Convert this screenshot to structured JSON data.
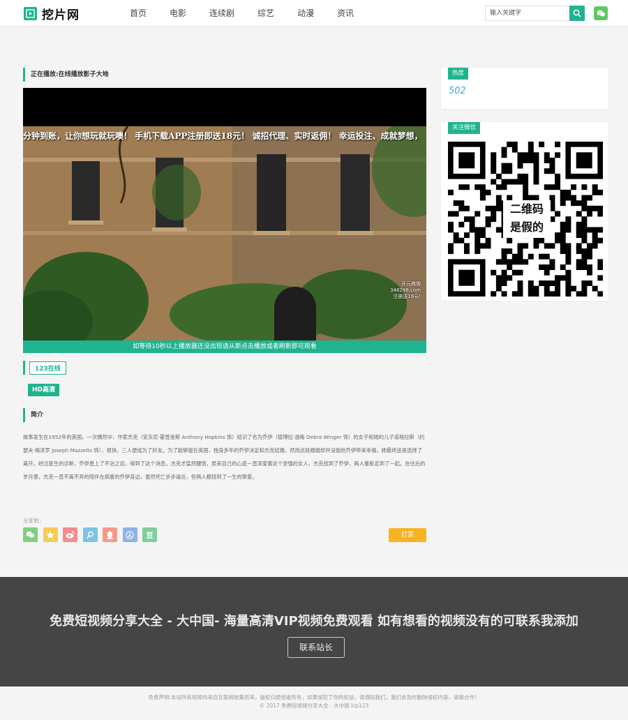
{
  "header": {
    "logo_text": "挖片网",
    "nav": [
      "首页",
      "电影",
      "连续剧",
      "综艺",
      "动漫",
      "资讯"
    ],
    "search_placeholder": "输入关键字"
  },
  "main": {
    "now_playing": "正在播放:在线播放影子大地",
    "marquee": "分钟到账，让你想玩就玩噢！ 手机下载APP注册即送18元！ 诚招代理、实时返佣！ 幸运投注、成就梦想，",
    "video_watermark": [
      "开元棋牌",
      "348298.com",
      "注册送18元!"
    ],
    "player_notice": "如等待10秒以上播放器还没出现请从新点击播放或者刷新即可观看",
    "online_tag": "123在线",
    "hd_tag": "HD高清",
    "intro_title": "简介",
    "description": "故事发生在1952年的英国，一次偶然中，作家杰克（安东尼·霍普金斯 Anthony Hopkins 饰）结识了名为乔伊（德博拉·温格 Debra Winger 饰）的女子和她的儿子道格拉斯（约瑟夫·梅泽罗 Joseph Mazzello 饰），很快，三人便成为了好友。为了能够留在英国，独身多年的乔伊决定和杰克结婚，然而这段婚姻却并没能给乔伊带来幸福，她最终还是选择了离开。经过医生的诊断，乔伊患上了不治之症，得到了这个消息，杰克才猛然醒悟，原来自己的心底一直深爱着这个坚强的女人，杰克找到了乔伊，两人重新走到了一起。在往后的岁月里，杰克一直不离不弃的陪伴在病重的乔伊身边，虽然死亡步步逼近，但两人都找到了一生的挚爱。",
    "share_label": "分享到：",
    "share_icons": [
      "wechat-icon",
      "qzone-icon",
      "weibo-icon",
      "tencent-weibo-icon",
      "qq-icon",
      "renren-icon",
      "douban-icon"
    ],
    "douban_glyph": "豆",
    "reward_label": "打赏"
  },
  "sidebar": {
    "hot_label": "热度",
    "hot_value": "502",
    "wechat_label": "关注微信",
    "qr_caption": [
      "二维码",
      "是假的"
    ]
  },
  "footer": {
    "title": "免费短视频分享大全 - 大中国- 海量高清VIP视频免费观看 如有想看的视频没有的可联系我添加",
    "contact_label": "联系站长",
    "disclaimer": "免责声明:本站所有视频均来自互联网收集而来，版权归原创者所有，如果侵犯了你的权益，请通知我们，我们会及时删除侵权内容，谢谢合作！",
    "copyright": "© 2017 免费短视频分享大全 - 大中国  icp123"
  },
  "colors": {
    "accent": "#20b38f",
    "reward": "#f7b324",
    "footer_bg": "#454545",
    "hot_value": "#3aaed8"
  }
}
